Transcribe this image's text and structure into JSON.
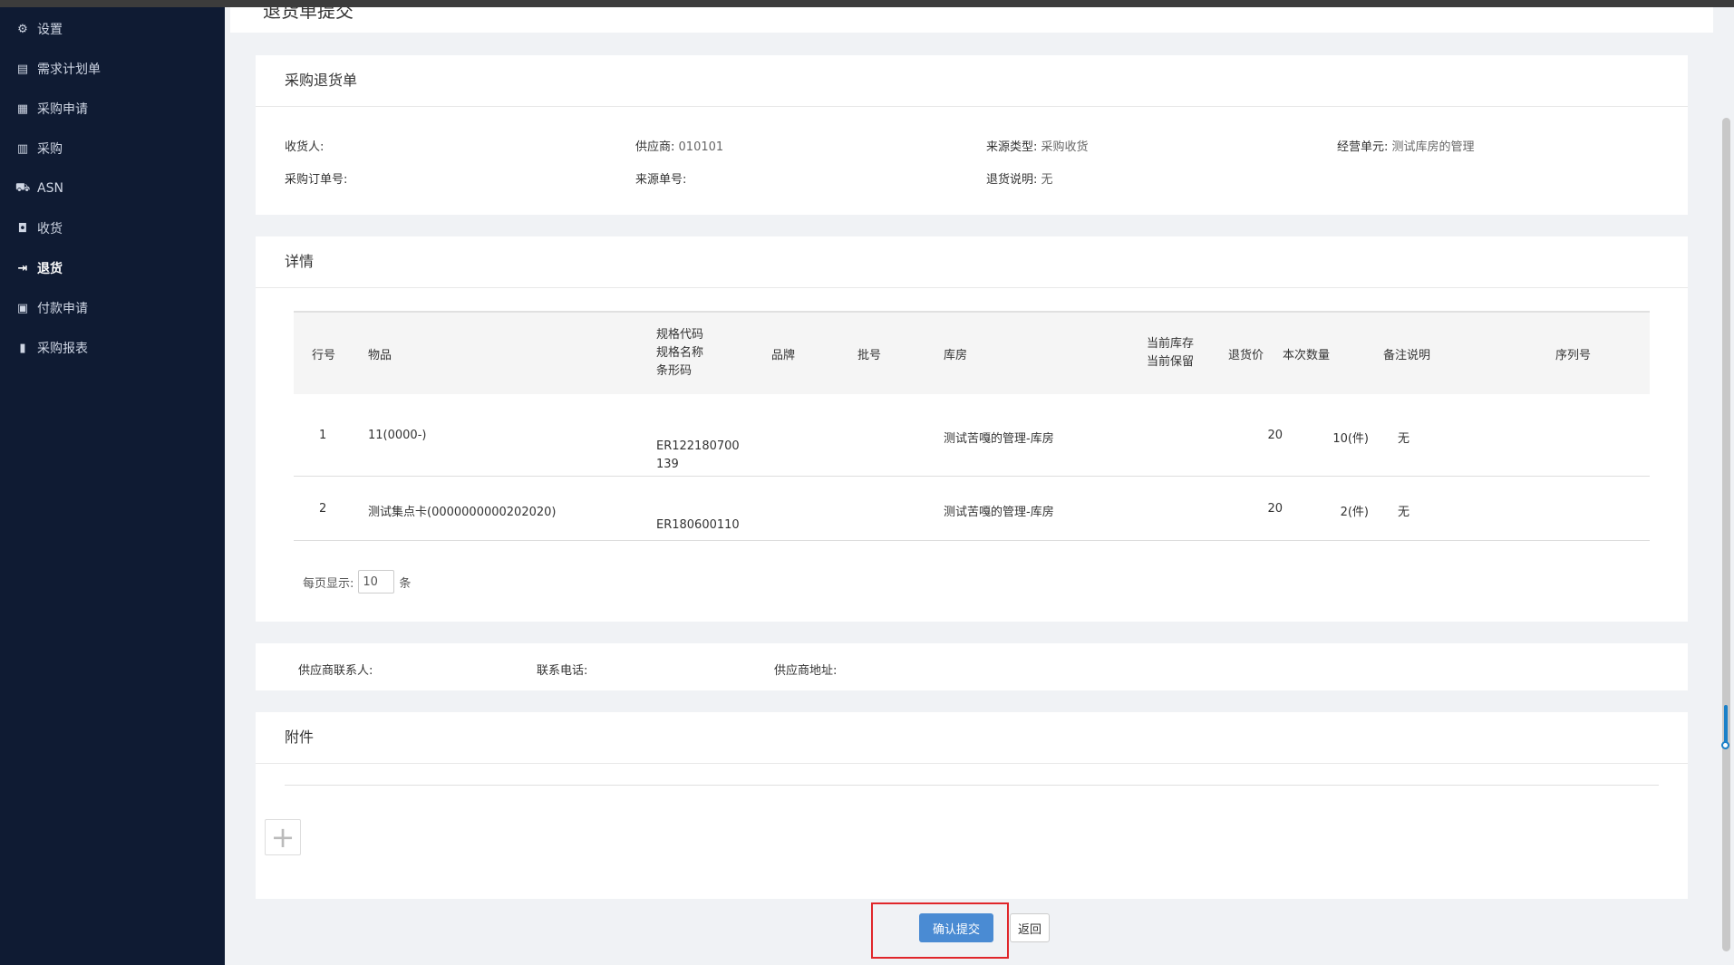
{
  "sidebar": {
    "items": [
      {
        "label": "设置",
        "icon": "gear-icon",
        "glyph": "⚙",
        "active": false
      },
      {
        "label": "需求计划单",
        "icon": "document-edit-icon",
        "glyph": "▤",
        "active": false
      },
      {
        "label": "采购申请",
        "icon": "clipboard-icon",
        "glyph": "▦",
        "active": false
      },
      {
        "label": "采购",
        "icon": "receipt-icon",
        "glyph": "▥",
        "active": false
      },
      {
        "label": "ASN",
        "icon": "truck-icon",
        "glyph": "⛟",
        "active": false
      },
      {
        "label": "收货",
        "icon": "inbox-icon",
        "glyph": "◘",
        "active": false
      },
      {
        "label": "退货",
        "icon": "sign-out-icon",
        "glyph": "⇥",
        "active": true
      },
      {
        "label": "付款申请",
        "icon": "payment-doc-icon",
        "glyph": "▣",
        "active": false
      },
      {
        "label": "采购报表",
        "icon": "bar-chart-icon",
        "glyph": "▮",
        "active": false
      }
    ]
  },
  "page": {
    "title": "退货单提交"
  },
  "order": {
    "title": "采购退货单",
    "receiver_label": "收货人:",
    "receiver_value": "",
    "supplier_label": "供应商:",
    "supplier_value": "010101",
    "source_type_label": "来源类型:",
    "source_type_value": "采购收货",
    "business_unit_label": "经营单元:",
    "business_unit_value": "测试库房的管理",
    "po_number_label": "采购订单号:",
    "po_number_value": "",
    "source_number_label": "来源单号:",
    "source_number_value": "",
    "return_note_label": "退货说明:",
    "return_note_value": "无"
  },
  "details": {
    "title": "详情",
    "headers": {
      "line": "行号",
      "item": "物品",
      "spec_code": "规格代码",
      "spec_name": "规格名称",
      "barcode": "条形码",
      "brand": "品牌",
      "batch": "批号",
      "warehouse": "库房",
      "stock": "当前库存",
      "reserved": "当前保留",
      "price": "退货价",
      "qty": "本次数量",
      "remark": "备注说明",
      "serial": "序列号"
    },
    "rows": [
      {
        "line": "1",
        "item": "11(0000-)",
        "barcode": "ER122180700139",
        "warehouse": "测试苦嘎的管理-库房",
        "price": "20",
        "qty": "10(件)",
        "remark": "无"
      },
      {
        "line": "2",
        "item": "测试集点卡(0000000000202020)",
        "barcode": "ER180600110",
        "warehouse": "测试苦嘎的管理-库房",
        "price": "20",
        "qty": "2(件)",
        "remark": "无"
      }
    ],
    "pager_label": "每页显示:",
    "pager_value": "10",
    "pager_unit": "条"
  },
  "contact": {
    "contact_label": "供应商联系人:",
    "phone_label": "联系电话:",
    "address_label": "供应商地址:"
  },
  "attachments": {
    "title": "附件",
    "add_glyph": "+"
  },
  "actions": {
    "confirm_label": "确认提交",
    "back_label": "返回"
  }
}
